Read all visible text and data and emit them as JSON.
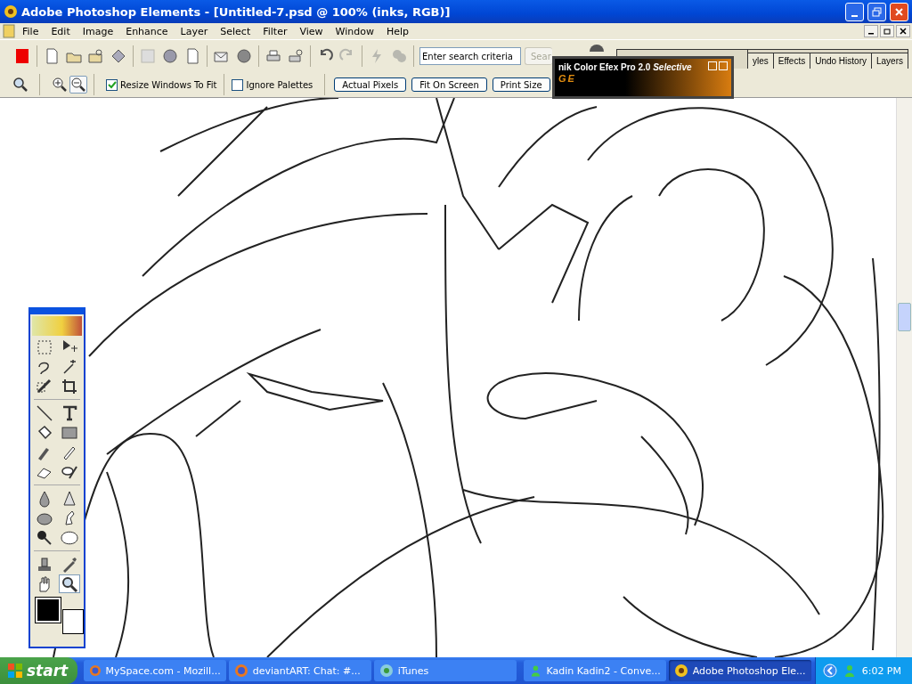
{
  "window": {
    "title": "Adobe Photoshop Elements - [Untitled-7.psd @ 100% (inks, RGB)]"
  },
  "menu": [
    "File",
    "Edit",
    "Image",
    "Enhance",
    "Layer",
    "Select",
    "Filter",
    "View",
    "Window",
    "Help"
  ],
  "shortcuts_bar": {
    "buttons": [
      {
        "disabled": false
      },
      {
        "disabled": false
      },
      {
        "disabled": false
      },
      {
        "disabled": false
      },
      {
        "disabled": false
      },
      {
        "disabled": true
      },
      {
        "disabled": false
      },
      {
        "disabled": false
      },
      {
        "disabled": false
      },
      {
        "disabled": false
      },
      {
        "disabled": false
      },
      {
        "disabled": false
      },
      {
        "disabled": false
      },
      {
        "disabled": true
      },
      {
        "disabled": true
      },
      {
        "disabled": true
      }
    ],
    "search": {
      "placeholder": "Enter search criteria"
    },
    "search_button": "Sear"
  },
  "palette_well": {
    "tabs": [
      "yles",
      "Effects",
      "Undo History",
      "Layers"
    ]
  },
  "options_bar": {
    "zoom_buttons": [
      {
        "selected": false
      },
      {
        "selected": true
      }
    ],
    "checkboxes": [
      {
        "label": "Resize Windows To Fit",
        "checked": true
      },
      {
        "label": "Ignore Palettes",
        "checked": false
      }
    ],
    "buttons": [
      "Actual Pixels",
      "Fit On Screen",
      "Print Size"
    ]
  },
  "plugin_window": {
    "title": "nik Color Efex Pro 2.0",
    "title_emphasis": "Selective",
    "subtitle": "GE"
  },
  "toolbox": {
    "tools": [
      {
        "selected": false
      },
      {
        "selected": false
      },
      {
        "selected": false
      },
      {
        "selected": false
      },
      {
        "selected": false
      },
      {
        "selected": false
      },
      {
        "selected": false
      },
      {
        "selected": false
      },
      {
        "selected": false
      },
      {
        "selected": false
      },
      {
        "selected": false
      },
      {
        "selected": false
      },
      {
        "selected": false
      },
      {
        "selected": false
      },
      {
        "selected": false
      },
      {
        "selected": false
      },
      {
        "selected": false
      },
      {
        "selected": false
      },
      {
        "selected": false
      },
      {
        "selected": false
      },
      {
        "selected": false
      },
      {
        "selected": false
      },
      {
        "selected": false
      },
      {
        "selected": true
      }
    ],
    "swatches": [
      {
        "color": "#000000"
      },
      {
        "color": "#ffffff"
      }
    ]
  },
  "taskbar": {
    "start": "start",
    "items": [
      {
        "label": "MySpace.com - Mozill...",
        "selected": false
      },
      {
        "label": "deviantART: Chat: #...",
        "selected": false
      },
      {
        "label": "iTunes",
        "selected": false
      },
      {
        "label": "Kadin Kadin2 - Conve...",
        "selected": false
      },
      {
        "label": "Adobe Photoshop Ele...",
        "selected": true
      }
    ],
    "clock": "6:02 PM"
  }
}
